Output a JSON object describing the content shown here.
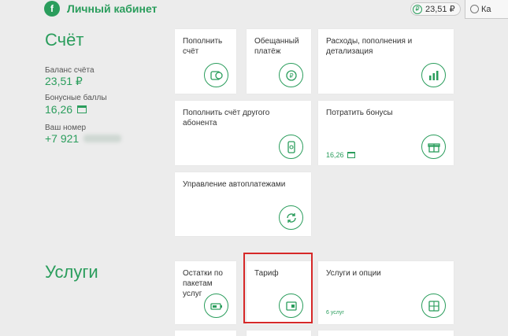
{
  "header": {
    "brand": "Личный кабинет",
    "balance": "23,51 ₽",
    "user": "Ка"
  },
  "account": {
    "title": "Счёт",
    "balance_label": "Баланс счёта",
    "balance_value": "23,51 ₽",
    "bonus_label": "Бонусные баллы",
    "bonus_value": "16,26",
    "number_label": "Ваш номер",
    "number_value": "+7 921"
  },
  "tiles": {
    "topup": "Пополнить счёт",
    "promised": "Обещанный платёж",
    "expenses": "Расходы, пополнения и детализация",
    "topup_other": "Пополнить счёт другого абонента",
    "spend_bonus": "Потратить бонусы",
    "spend_bonus_value": "16,26",
    "autopay": "Управление автоплатежами"
  },
  "services": {
    "title": "Услуги",
    "remaining": "Остатки по пакетам услуг",
    "tariff": "Тариф",
    "options": "Услуги и опции",
    "options_count": "6 услуг"
  },
  "colors": {
    "accent": "#2a9d5c",
    "highlight": "#d62828",
    "background": "#ececec"
  }
}
